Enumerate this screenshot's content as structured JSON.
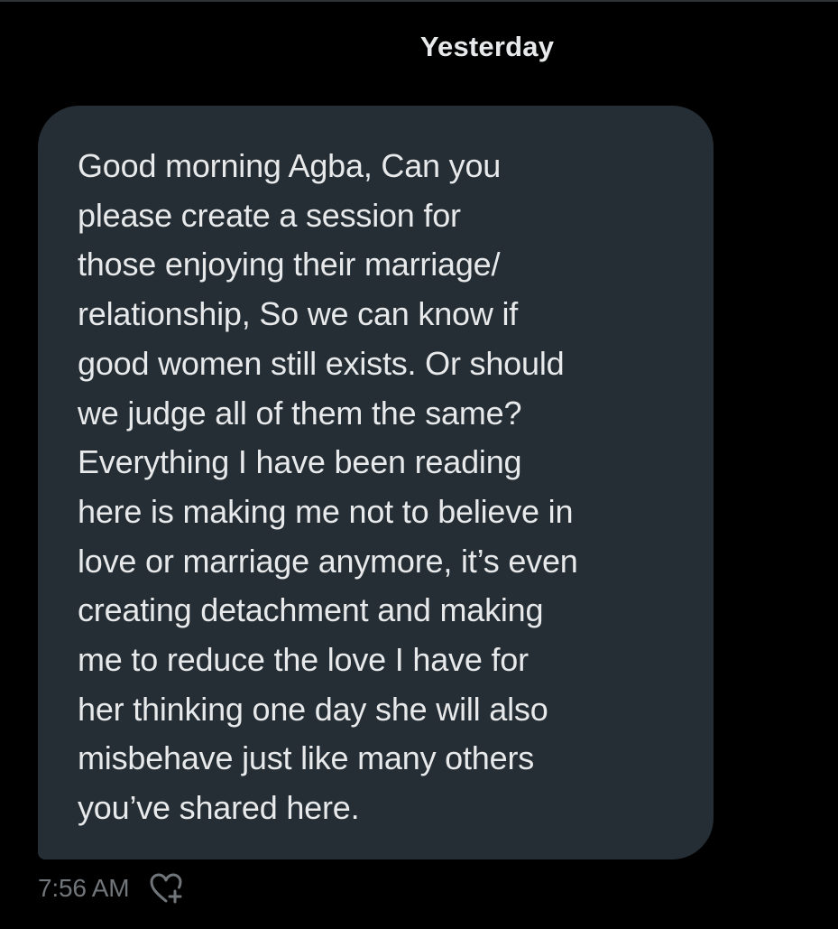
{
  "conversation": {
    "date_divider": "Yesterday"
  },
  "message": {
    "text": "Good morning Agba, Can you\nplease create a session for\nthose enjoying their marriage/\nrelationship, So we can know if\ngood women still exists. Or should\nwe judge all of them the same?\nEverything I have been reading\nhere is making me not to believe in\nlove or marriage anymore, it’s even\ncreating  detachment and making\nme to reduce the love I have for\nher thinking one day she will also\nmisbehave just like many others\nyou’ve shared here.",
    "timestamp": "7:56 AM",
    "react_icon": "heart-plus-icon"
  },
  "colors": {
    "background": "#000000",
    "bubble": "#252e35",
    "text": "#e7e9ea",
    "muted": "#71767b"
  }
}
